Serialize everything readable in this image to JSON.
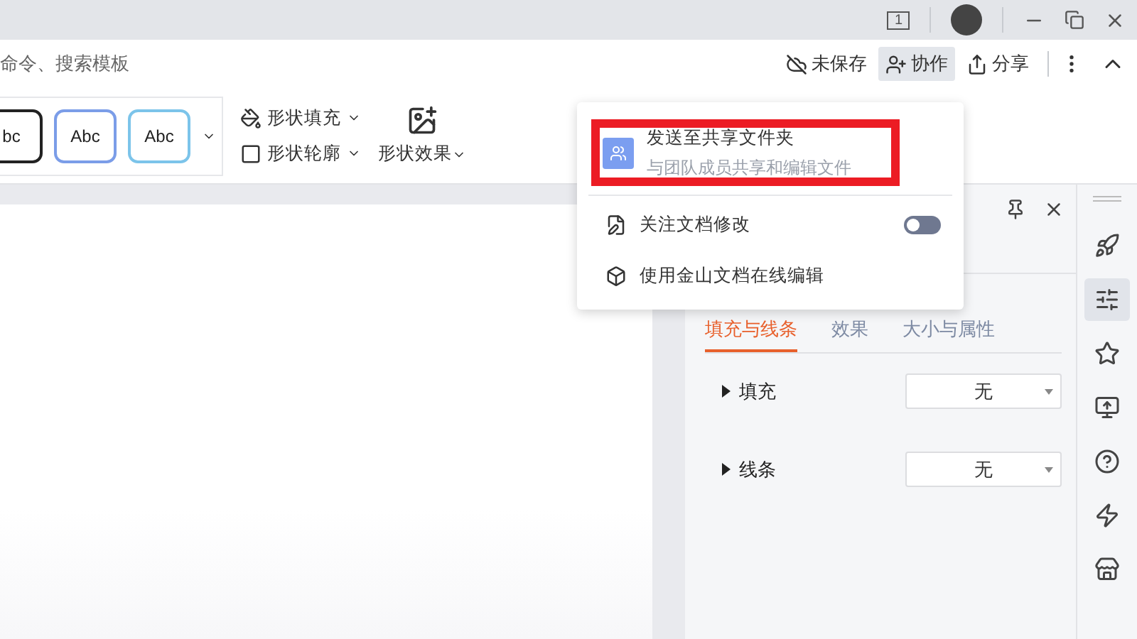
{
  "titlebar": {
    "page_badge": "1"
  },
  "toolbar": {
    "search_hint": "命令、搜索模板",
    "save_status": "未保存",
    "collab": {
      "label": "协作",
      "selected": true
    },
    "share": "分享"
  },
  "ribbon": {
    "styles": [
      {
        "label": "bc",
        "color": "#222222"
      },
      {
        "label": "Abc",
        "color": "#7b9de8"
      },
      {
        "label": "Abc",
        "color": "#7cc4ea"
      }
    ],
    "tools": [
      {
        "kind": "fill",
        "label": "形状填充"
      },
      {
        "kind": "outline",
        "label": "形状轮廓"
      }
    ],
    "effects": "形状效果"
  },
  "collab_menu": {
    "items": [
      {
        "kind": "share",
        "title": "发送至共享文件夹",
        "subtitle": "与团队成员共享和编辑文件",
        "highlighted": true
      },
      {
        "kind": "toggle",
        "title": "关注文档修改",
        "on": false
      },
      {
        "kind": "link",
        "title": "使用金山文档在线编辑"
      }
    ]
  },
  "panel": {
    "tabs": [
      {
        "label": "填充与线条",
        "selected": true
      },
      {
        "label": "效果",
        "selected": false
      },
      {
        "label": "大小与属性",
        "selected": false
      }
    ],
    "sections": [
      {
        "label": "填充",
        "value": "无",
        "expanded": false
      },
      {
        "label": "线条",
        "value": "无",
        "expanded": false
      }
    ]
  },
  "sidebar": {
    "items": [
      {
        "kind": "rocket",
        "selected": false
      },
      {
        "kind": "sliders",
        "selected": true
      },
      {
        "kind": "star",
        "selected": false
      },
      {
        "kind": "screen",
        "selected": false
      },
      {
        "kind": "help",
        "selected": false
      },
      {
        "kind": "bolt",
        "selected": false
      },
      {
        "kind": "store",
        "selected": false
      }
    ]
  }
}
